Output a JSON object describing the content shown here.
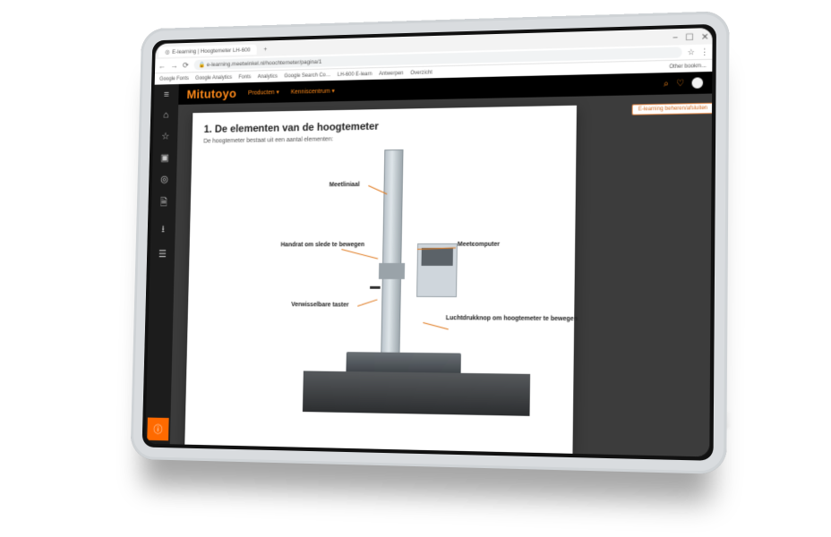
{
  "browser": {
    "tab_title": "E-learning | Hoogtemeter LH-600",
    "url": "e-learning.meetwinkel.nl/hoochterneter/pagina/1",
    "bookmarks": [
      "Google Fonts",
      "Google Analytics",
      "Fonts",
      "Analytics",
      "Google Search Co…",
      "LH-600 E-learn",
      "Antwerpen",
      "Overzicht"
    ],
    "bookmarks_rest": "Other bookm…"
  },
  "app": {
    "brand": "Mitutoyo",
    "nav": [
      "Producten ▾",
      "Kenniscentrum ▾"
    ],
    "right_chip": "E-learning beheren/afsluiten"
  },
  "page": {
    "title": "1. De elementen van de hoogtemeter",
    "subtitle": "De hoogtemeter bestaat uit een aantal elementen:"
  },
  "labels": {
    "meetliniaal": "Meetliniaal",
    "handrat": "Handrat om slede te bewegen",
    "taster": "Verwisselbare taster",
    "computer": "Meetcomputer",
    "lucht": "Luchtdrukknop om hoogtemeter te bewegen"
  }
}
